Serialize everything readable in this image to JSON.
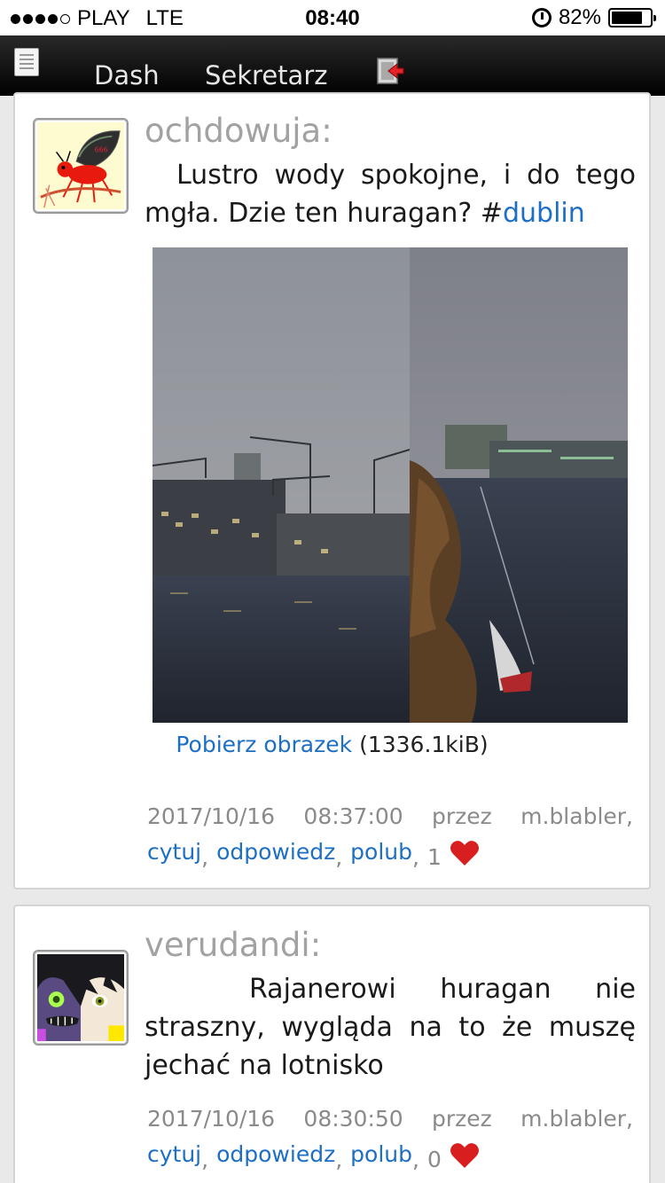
{
  "status_bar": {
    "carrier": "PLAY",
    "network": "LTE",
    "time": "08:40",
    "battery": "82%",
    "battery_level": 0.82,
    "signal_bars": 4,
    "icons": [
      "signal-dots-icon",
      "alarm-icon",
      "battery-icon"
    ]
  },
  "nav": {
    "items": [
      {
        "label": "Dash"
      },
      {
        "label": "Sekretarz"
      }
    ],
    "icons": [
      "document-icon",
      "exit-icon"
    ]
  },
  "posts": [
    {
      "author": "ochdowuja:",
      "text": "Lustro wody spokojne, i do tego mgła. Dzie ten huragan? #",
      "hashtag": "dublin",
      "download_link": "Pobierz obrazek",
      "download_size": "(1336.1kiB)",
      "date": "2017/10/16",
      "time": "08:37:00",
      "via_label": "przez",
      "via": "m.blabler,",
      "actions": [
        "cytuj",
        "odpowiedz",
        "polub"
      ],
      "like_count": "1",
      "heart_color": "#d81e1e"
    },
    {
      "author": "verudandi:",
      "text": "Rajanerowi huragan nie straszny, wygląda na to że muszę jechać na lotnisko",
      "date": "2017/10/16",
      "time": "08:30:50",
      "via_label": "przez",
      "via": "m.blabler,",
      "actions": [
        "cytuj",
        "odpowiedz",
        "polub"
      ],
      "like_count": "0",
      "heart_color": "#d81e1e"
    }
  ],
  "colors": {
    "link": "#1c6fc4",
    "author": "#a2a2a2",
    "meta": "#8a8a8a",
    "nav_bg": "#000000"
  }
}
